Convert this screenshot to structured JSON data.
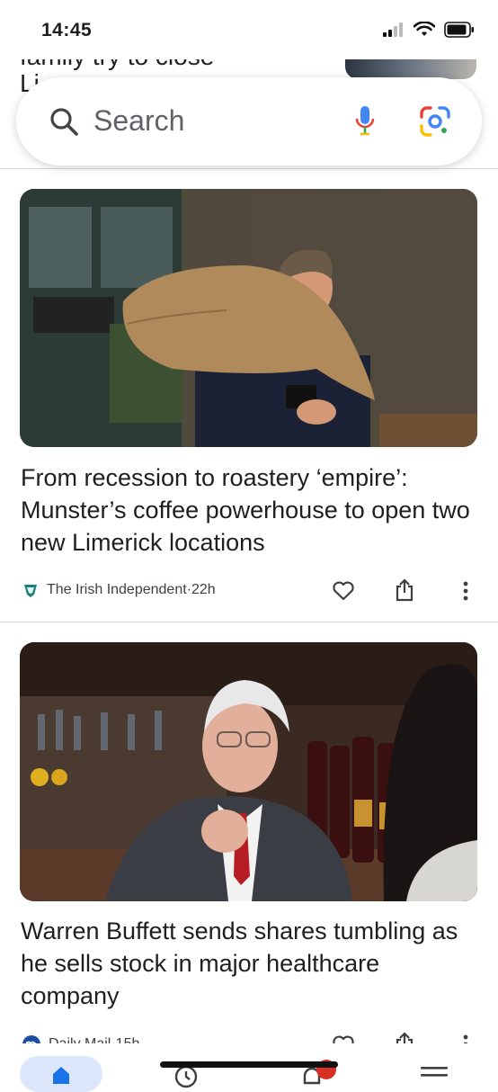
{
  "status_bar": {
    "time": "14:45"
  },
  "background_peek": {
    "text": "family try to close\nLi"
  },
  "search": {
    "placeholder": "Search"
  },
  "articles": [
    {
      "headline": "From recession to roastery ‘empire’: Munster’s coffee powerhouse to open two new Limerick locations",
      "source": "The Irish Independent",
      "age": "22h",
      "image_alt": "Man carrying a coffee sack holding a mug"
    },
    {
      "headline": "Warren Buffett sends shares tumbling as he sells stock in major healthcare company",
      "source": "Daily Mail",
      "age": "15h",
      "image_alt": "Warren Buffett speaking at a bar"
    }
  ],
  "separator": " · ",
  "colors": {
    "accent": "#1a73e8",
    "nav_pill": "#dde7fb",
    "badge": "#d93025"
  },
  "icons": [
    "search-icon",
    "mic-icon",
    "lens-icon",
    "heart-icon",
    "share-icon",
    "more-icon",
    "home-icon"
  ]
}
